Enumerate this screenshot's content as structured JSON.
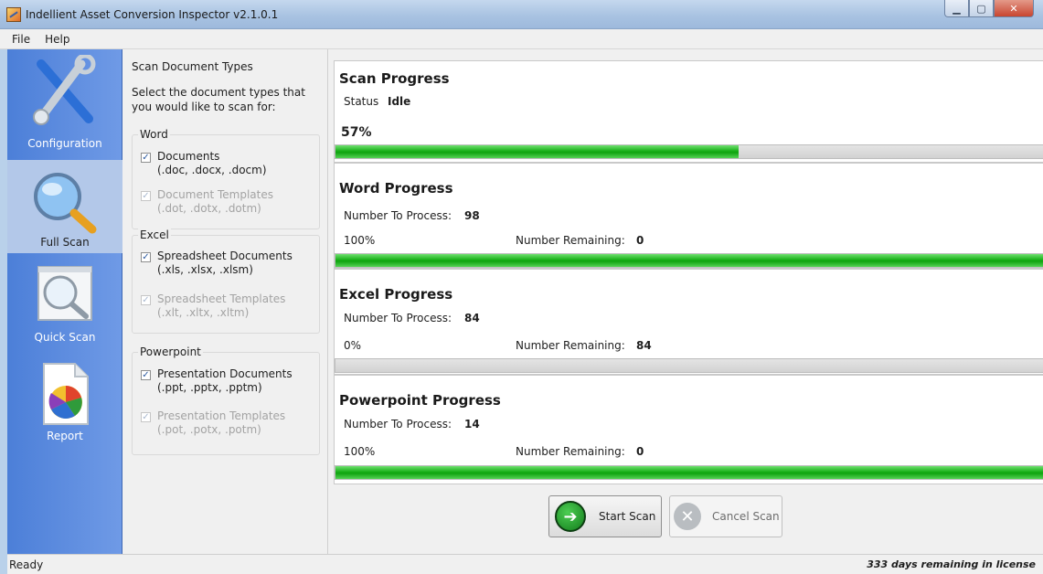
{
  "window": {
    "title": "Indellient Asset Conversion Inspector v2.1.0.1",
    "minimize_icon": "minimize-icon",
    "maximize_icon": "maximize-icon",
    "close_icon": "close-icon"
  },
  "menu": [
    "File",
    "Help"
  ],
  "nav": {
    "items": [
      {
        "label": "Configuration",
        "icon": "wrench-screwdriver-icon",
        "selected": false
      },
      {
        "label": "Full Scan",
        "icon": "magnifier-icon",
        "selected": true
      },
      {
        "label": "Quick Scan",
        "icon": "magnifier-window-icon",
        "selected": false
      },
      {
        "label": "Report",
        "icon": "pie-chart-report-icon",
        "selected": false
      }
    ]
  },
  "options": {
    "heading": "Scan Document Types",
    "description": "Select the document types that you would like to scan for:",
    "groups": [
      {
        "title": "Word",
        "items": [
          {
            "label": "Documents",
            "ext": "(.doc, .docx, .docm)",
            "checked": true,
            "enabled": true
          },
          {
            "label": "Document Templates",
            "ext": "(.dot, .dotx, .dotm)",
            "checked": true,
            "enabled": false
          }
        ]
      },
      {
        "title": "Excel",
        "items": [
          {
            "label": "Spreadsheet Documents",
            "ext": "(.xls, .xlsx, .xlsm)",
            "checked": true,
            "enabled": true
          },
          {
            "label": "Spreadsheet Templates",
            "ext": "(.xlt, .xltx, .xltm)",
            "checked": true,
            "enabled": false
          }
        ]
      },
      {
        "title": "Powerpoint",
        "items": [
          {
            "label": "Presentation Documents",
            "ext": "(.ppt, .pptx, .pptm)",
            "checked": true,
            "enabled": true
          },
          {
            "label": "Presentation Templates",
            "ext": "(.pot, .potx, .potm)",
            "checked": true,
            "enabled": false
          }
        ]
      }
    ]
  },
  "scan": {
    "title": "Scan Progress",
    "status_label": "Status",
    "status_value": "Idle",
    "percent_text": "57%",
    "percent": 57
  },
  "word": {
    "title": "Word Progress",
    "to_process_label": "Number To Process:",
    "to_process": "98",
    "percent_text": "100%",
    "remaining_label": "Number Remaining:",
    "remaining": "0",
    "percent": 100
  },
  "excel": {
    "title": "Excel Progress",
    "to_process_label": "Number To Process:",
    "to_process": "84",
    "percent_text": "0%",
    "remaining_label": "Number Remaining:",
    "remaining": "84",
    "percent": 0
  },
  "powerpoint": {
    "title": "Powerpoint Progress",
    "to_process_label": "Number To Process:",
    "to_process": "14",
    "percent_text": "100%",
    "remaining_label": "Number Remaining:",
    "remaining": "0",
    "percent": 100
  },
  "buttons": {
    "start": {
      "label": "Start Scan",
      "icon": "arrow-right-circle-icon"
    },
    "cancel": {
      "label": "Cancel Scan",
      "icon": "x-circle-icon"
    }
  },
  "status": {
    "left": "Ready",
    "right": "333 days remaining in license"
  },
  "colors": {
    "nav_bg": "#5a89dd",
    "progress_green": "#19b019",
    "start_icon": "#1f9a2a"
  }
}
